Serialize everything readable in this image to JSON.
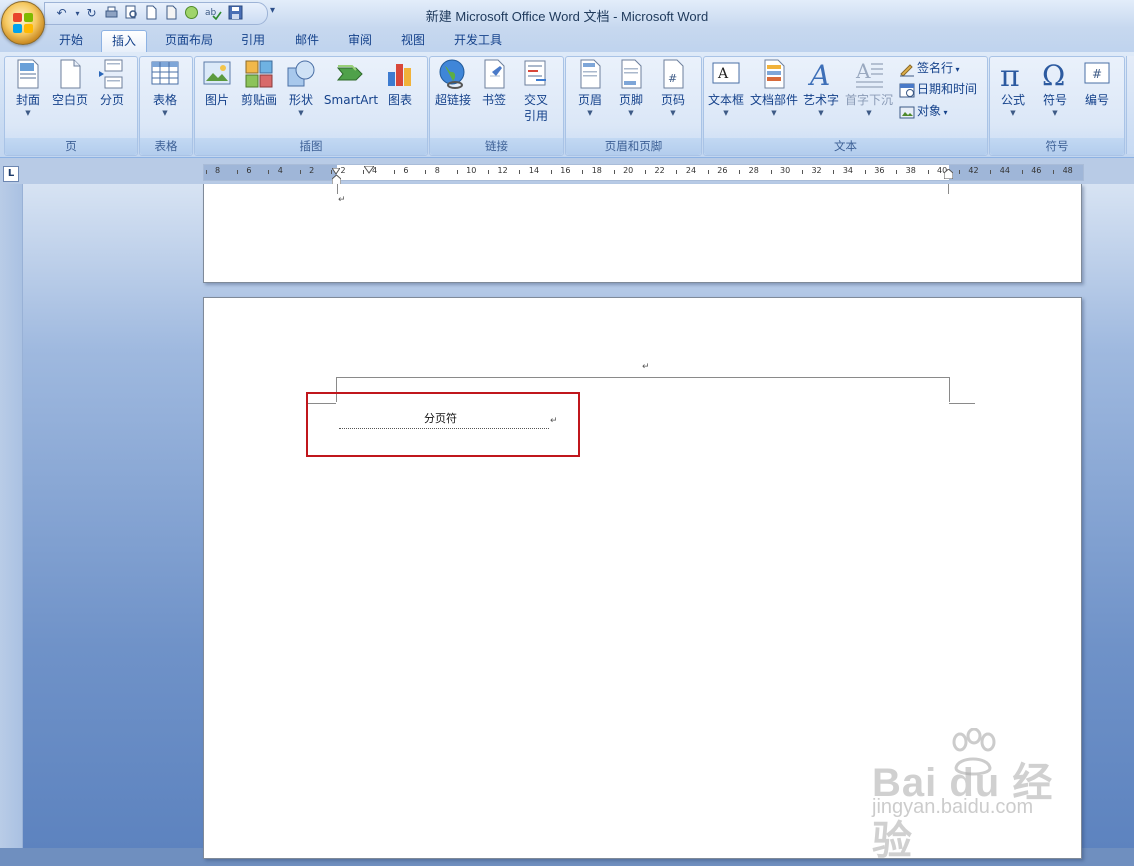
{
  "window": {
    "title": "新建 Microsoft Office Word 文档 - Microsoft Word"
  },
  "tabs": [
    {
      "label": "开始"
    },
    {
      "label": "插入",
      "active": true
    },
    {
      "label": "页面布局"
    },
    {
      "label": "引用"
    },
    {
      "label": "邮件"
    },
    {
      "label": "审阅"
    },
    {
      "label": "视图"
    },
    {
      "label": "开发工具"
    }
  ],
  "ribbon": {
    "groups": {
      "pages": {
        "label": "页",
        "buttons": [
          "封面",
          "空白页",
          "分页"
        ]
      },
      "tables": {
        "label": "表格",
        "buttons": [
          "表格"
        ]
      },
      "illustrations": {
        "label": "插图",
        "buttons": [
          "图片",
          "剪贴画",
          "形状",
          "SmartArt",
          "图表"
        ]
      },
      "links": {
        "label": "链接",
        "buttons": [
          "超链接",
          "书签",
          "交叉",
          "引用"
        ]
      },
      "header_footer": {
        "label": "页眉和页脚",
        "buttons": [
          "页眉",
          "页脚",
          "页码"
        ]
      },
      "text": {
        "label": "文本",
        "buttons": [
          "文本框",
          "文档部件",
          "艺术字",
          "首字下沉"
        ],
        "small": [
          "签名行",
          "日期和时间",
          "对象"
        ]
      },
      "symbols": {
        "label": "符号",
        "buttons": [
          "公式",
          "符号",
          "编号"
        ]
      }
    }
  },
  "ruler": {
    "tick_labels": [
      "8",
      "6",
      "4",
      "2",
      "2",
      "4",
      "6",
      "8",
      "10",
      "12",
      "14",
      "16",
      "18",
      "20",
      "22",
      "24",
      "26",
      "28",
      "30",
      "32",
      "34",
      "36",
      "38",
      "40",
      "42",
      "44",
      "46",
      "48"
    ]
  },
  "document": {
    "paragraph_mark": "↵",
    "page_break_label": "分页符",
    "highlight_color": "#c0161c"
  },
  "watermark": {
    "logo": "Bai du 经验",
    "url": "jingyan.baidu.com"
  }
}
